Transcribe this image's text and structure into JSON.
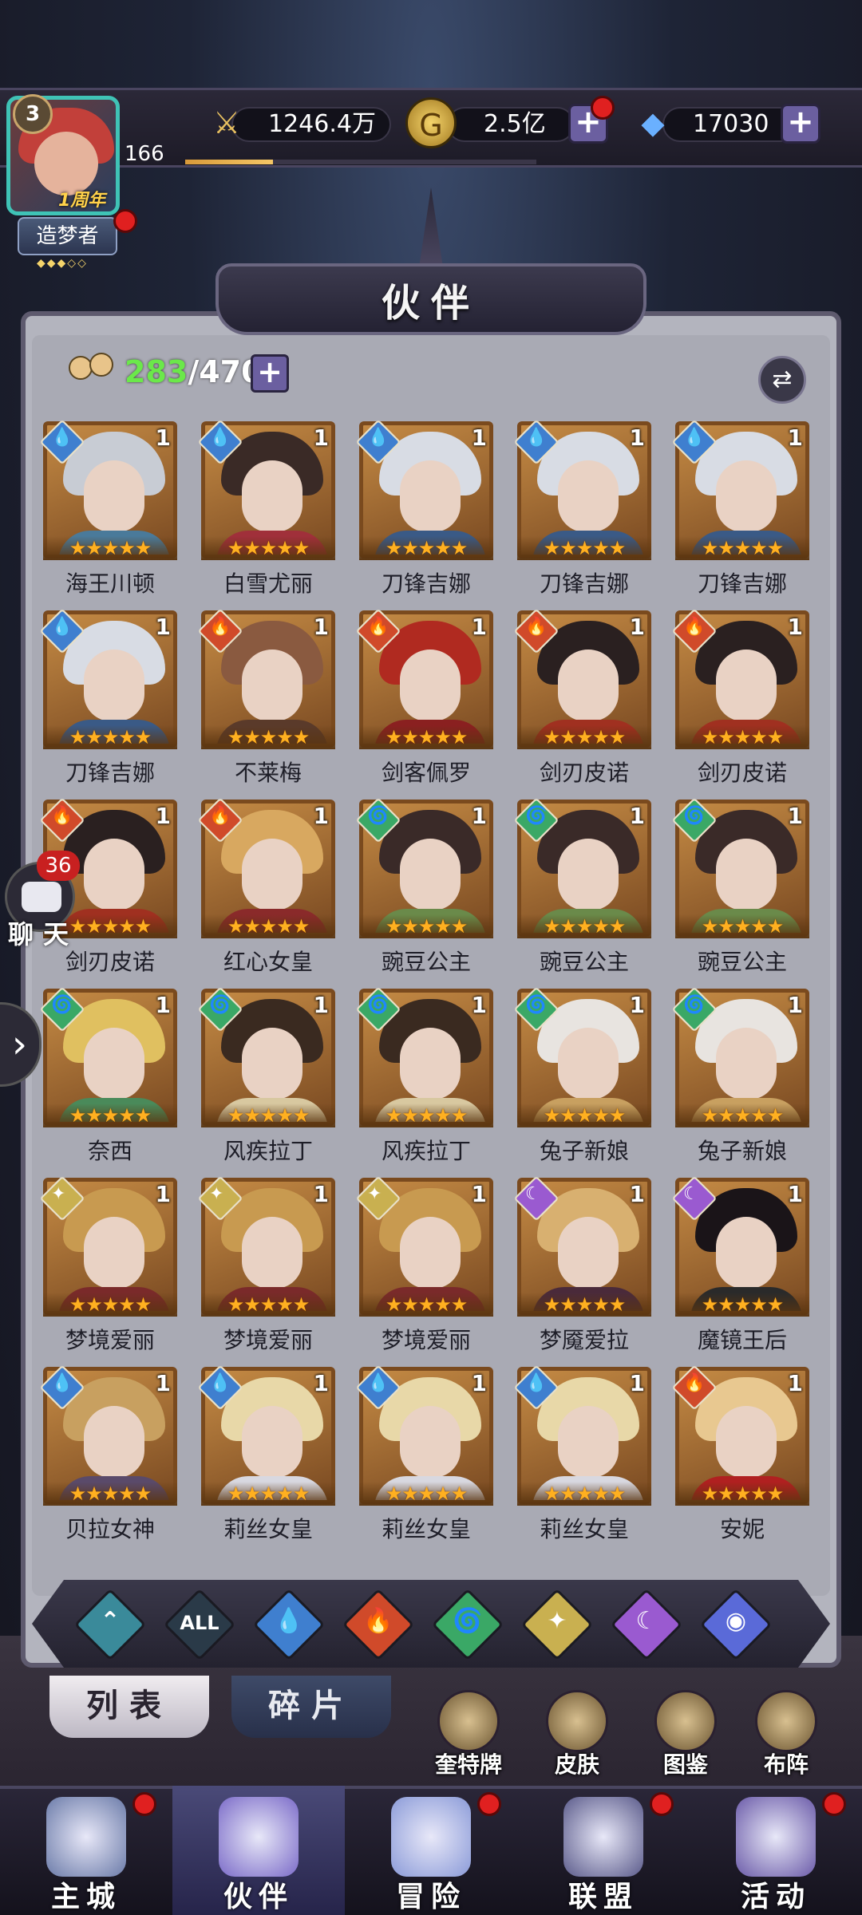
{
  "player": {
    "vip_level": "3",
    "level": "166",
    "anniversary": "1周年",
    "title": "造梦者",
    "title_stars": "◆◆◆◇◇",
    "exp_fraction": 0.25
  },
  "resources": {
    "power": "1246.4万",
    "gold": "2.5亿",
    "diamond": "17030"
  },
  "header": {
    "title": "伙伴"
  },
  "collection": {
    "owned": "283",
    "total": "/470"
  },
  "elements": {
    "water": {
      "color": "#3f7fcf",
      "glyph": "💧"
    },
    "fire": {
      "color": "#d04a2a",
      "glyph": "🔥"
    },
    "wind": {
      "color": "#3aa866",
      "glyph": "🌀"
    },
    "light": {
      "color": "#c9b050",
      "glyph": "✦"
    },
    "dark": {
      "color": "#9a5ad0",
      "glyph": "☾"
    }
  },
  "cards": [
    {
      "name": "海王川顿",
      "level": "1",
      "element": "water",
      "stars": "★★★★★",
      "hair": "#c8ccd4",
      "body": "#4a7a9a"
    },
    {
      "name": "白雪尤丽",
      "level": "1",
      "element": "water",
      "stars": "★★★★★",
      "hair": "#3a2a26",
      "body": "#a0303a"
    },
    {
      "name": "刀锋吉娜",
      "level": "1",
      "element": "water",
      "stars": "★★★★★",
      "hair": "#d8dce4",
      "body": "#3a5a86"
    },
    {
      "name": "刀锋吉娜",
      "level": "1",
      "element": "water",
      "stars": "★★★★★",
      "hair": "#d8dce4",
      "body": "#3a5a86"
    },
    {
      "name": "刀锋吉娜",
      "level": "1",
      "element": "water",
      "stars": "★★★★★",
      "hair": "#d8dce4",
      "body": "#3a5a86"
    },
    {
      "name": "刀锋吉娜",
      "level": "1",
      "element": "water",
      "stars": "★★★★★",
      "hair": "#d8dce4",
      "body": "#3a5a86"
    },
    {
      "name": "不莱梅",
      "level": "1",
      "element": "fire",
      "stars": "★★★★★",
      "hair": "#8a5a40",
      "body": "#5a3a2a"
    },
    {
      "name": "剑客佩罗",
      "level": "1",
      "element": "fire",
      "stars": "★★★★★",
      "hair": "#b02a20",
      "body": "#8a2020"
    },
    {
      "name": "剑刃皮诺",
      "level": "1",
      "element": "fire",
      "stars": "★★★★★",
      "hair": "#2a2020",
      "body": "#a03020"
    },
    {
      "name": "剑刃皮诺",
      "level": "1",
      "element": "fire",
      "stars": "★★★★★",
      "hair": "#2a2020",
      "body": "#a03020"
    },
    {
      "name": "剑刃皮诺",
      "level": "1",
      "element": "fire",
      "stars": "★★★★★",
      "hair": "#2a2020",
      "body": "#a03020"
    },
    {
      "name": "红心女皇",
      "level": "1",
      "element": "fire",
      "stars": "★★★★★",
      "hair": "#d8a860",
      "body": "#8a2a2a"
    },
    {
      "name": "豌豆公主",
      "level": "1",
      "element": "wind",
      "stars": "★★★★★",
      "hair": "#3a2a28",
      "body": "#6a8a4a"
    },
    {
      "name": "豌豆公主",
      "level": "1",
      "element": "wind",
      "stars": "★★★★★",
      "hair": "#3a2a28",
      "body": "#6a8a4a"
    },
    {
      "name": "豌豆公主",
      "level": "1",
      "element": "wind",
      "stars": "★★★★★",
      "hair": "#3a2a28",
      "body": "#6a8a4a"
    },
    {
      "name": "奈西",
      "level": "1",
      "element": "wind",
      "stars": "★★★★★",
      "hair": "#e0c060",
      "body": "#4a8a5a"
    },
    {
      "name": "风疾拉丁",
      "level": "1",
      "element": "wind",
      "stars": "★★★★★",
      "hair": "#3a2a20",
      "body": "#d8c8a0"
    },
    {
      "name": "风疾拉丁",
      "level": "1",
      "element": "wind",
      "stars": "★★★★★",
      "hair": "#3a2a20",
      "body": "#d8c8a0"
    },
    {
      "name": "兔子新娘",
      "level": "1",
      "element": "wind",
      "stars": "★★★★★",
      "hair": "#e8e4e0",
      "body": "#c8a060"
    },
    {
      "name": "兔子新娘",
      "level": "1",
      "element": "wind",
      "stars": "★★★★★",
      "hair": "#e8e4e0",
      "body": "#c8a060"
    },
    {
      "name": "梦境爱丽",
      "level": "1",
      "element": "light",
      "stars": "★★★★★",
      "hair": "#c89a50",
      "body": "#7a2a2a"
    },
    {
      "name": "梦境爱丽",
      "level": "1",
      "element": "light",
      "stars": "★★★★★",
      "hair": "#c89a50",
      "body": "#7a2a2a"
    },
    {
      "name": "梦境爱丽",
      "level": "1",
      "element": "light",
      "stars": "★★★★★",
      "hair": "#c89a50",
      "body": "#7a2a2a"
    },
    {
      "name": "梦魇爱拉",
      "level": "1",
      "element": "dark",
      "stars": "★★★★★",
      "hair": "#d8b070",
      "body": "#4a2a3a"
    },
    {
      "name": "魔镜王后",
      "level": "1",
      "element": "dark",
      "stars": "★★★★★",
      "hair": "#1a1418",
      "body": "#2a2a2a"
    },
    {
      "name": "贝拉女神",
      "level": "1",
      "element": "water",
      "stars": "★★★★★",
      "hair": "#c8a060",
      "body": "#5a4a6a"
    },
    {
      "name": "莉丝女皇",
      "level": "1",
      "element": "water",
      "stars": "★★★★★",
      "hair": "#e8d8a8",
      "body": "#d8d8e0"
    },
    {
      "name": "莉丝女皇",
      "level": "1",
      "element": "water",
      "stars": "★★★★★",
      "hair": "#e8d8a8",
      "body": "#d8d8e0"
    },
    {
      "name": "莉丝女皇",
      "level": "1",
      "element": "water",
      "stars": "★★★★★",
      "hair": "#e8d8a8",
      "body": "#d8d8e0"
    },
    {
      "name": "安妮",
      "level": "1",
      "element": "fire",
      "stars": "★★★★★",
      "hair": "#e8c890",
      "body": "#b02020"
    }
  ],
  "filters": [
    {
      "name": "filter-pierce",
      "color": "#3a8a9a",
      "glyph": "⌃"
    },
    {
      "name": "filter-all",
      "color": "#2a3a48",
      "glyph": "ALL"
    },
    {
      "name": "filter-water",
      "color": "#3f7fcf",
      "glyph": "💧"
    },
    {
      "name": "filter-fire",
      "color": "#d04a2a",
      "glyph": "🔥"
    },
    {
      "name": "filter-wind",
      "color": "#3aa866",
      "glyph": "🌀"
    },
    {
      "name": "filter-light",
      "color": "#c9b050",
      "glyph": "✦"
    },
    {
      "name": "filter-dark",
      "color": "#9a5ad0",
      "glyph": "☾"
    },
    {
      "name": "filter-cosmic",
      "color": "#5a6ad8",
      "glyph": "◉"
    }
  ],
  "tabs": {
    "list": "列表",
    "fragments": "碎片"
  },
  "functions": [
    {
      "label": "奎特牌"
    },
    {
      "label": "皮肤"
    },
    {
      "label": "图鉴"
    },
    {
      "label": "布阵"
    }
  ],
  "chat": {
    "label": "聊天",
    "badge": "36"
  },
  "nav": [
    {
      "label": "主城",
      "color": "#6a7aa8",
      "dot": true
    },
    {
      "label": "伙伴",
      "color": "#7a6ac8",
      "dot": false
    },
    {
      "label": "冒险",
      "color": "#8a9ad8",
      "dot": true
    },
    {
      "label": "联盟",
      "color": "#5a5a8a",
      "dot": true
    },
    {
      "label": "活动",
      "color": "#6a5aa8",
      "dot": true
    }
  ]
}
